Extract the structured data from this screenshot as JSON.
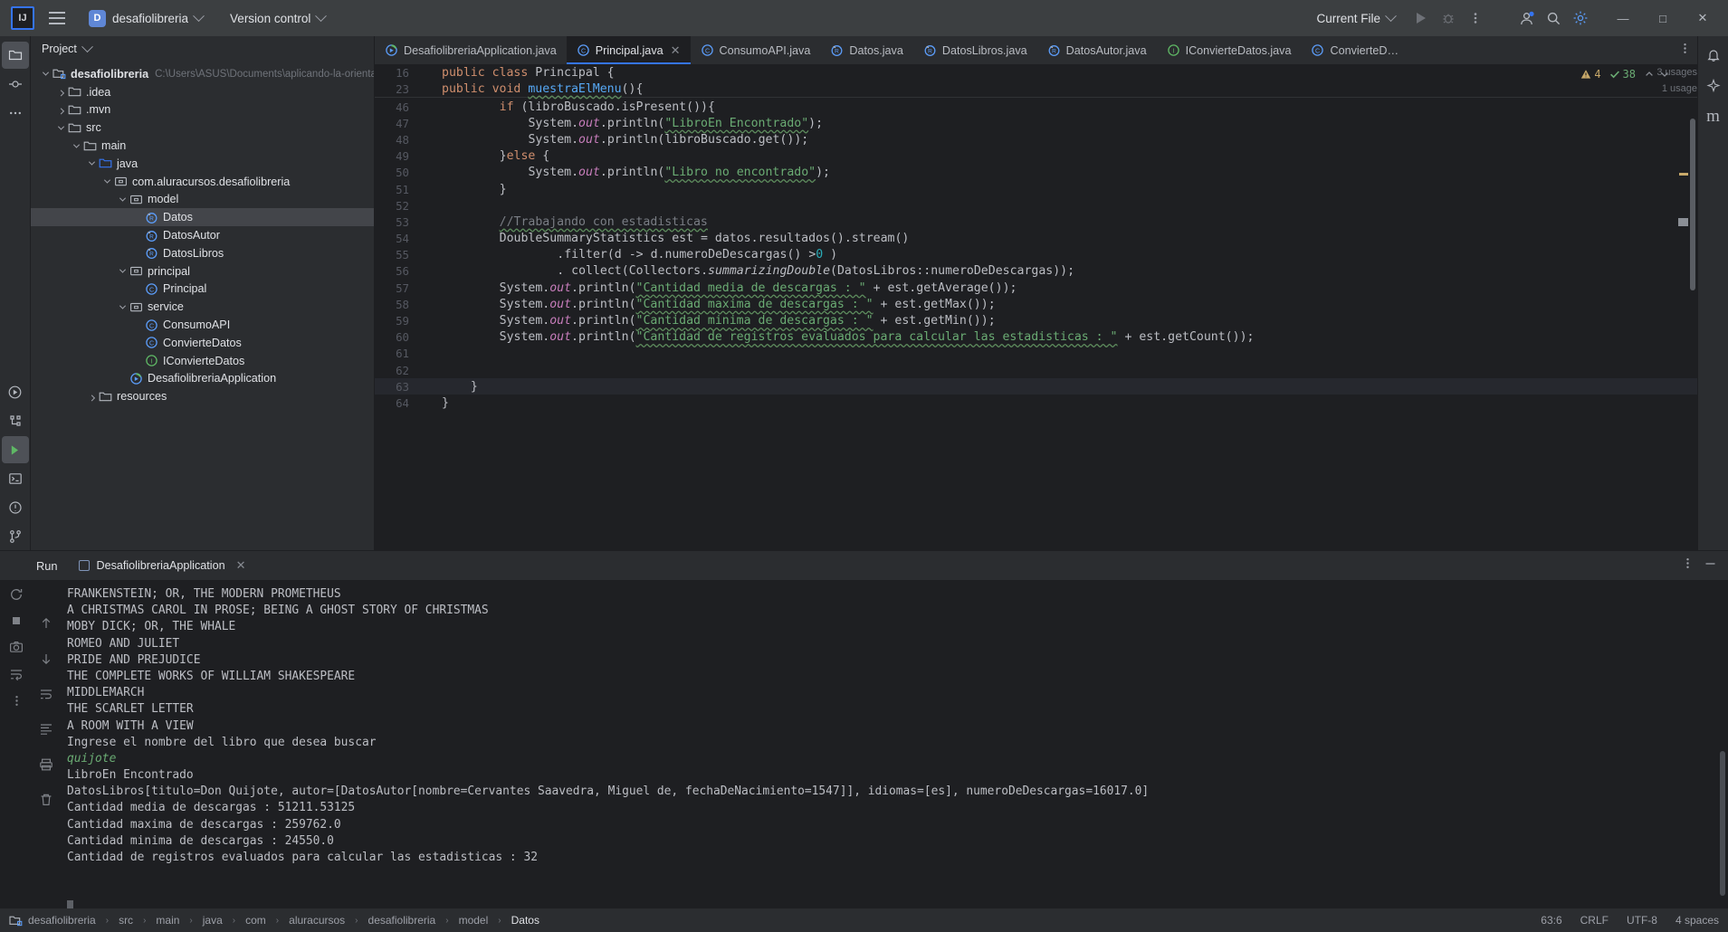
{
  "titlebar": {
    "logo_icon": "intellij-logo-icon",
    "menu_icon": "hamburger-menu-icon",
    "project_badge": "D",
    "project_name": "desafiolibreria",
    "vcs_label": "Version control",
    "run_config": "Current File",
    "run_icon": "run-play-icon",
    "debug_icon": "debug-bug-icon",
    "more_icon": "more-vertical-icon",
    "account_icon": "user-account-icon",
    "search_icon": "search-icon",
    "settings_icon": "gear-icon",
    "minimize": "—",
    "maximize": "□",
    "close": "✕"
  },
  "activity_bar_left": [
    {
      "name": "project-tool-window",
      "icon": "project-folder-icon",
      "selected": true
    },
    {
      "name": "commit-tool-window",
      "icon": "commit-icon",
      "selected": false
    },
    {
      "name": "more-tool-windows",
      "icon": "ellipsis-icon",
      "selected": false
    },
    {
      "name": "run-tool-window",
      "icon": "run-circle-icon",
      "selected": false
    },
    {
      "name": "structure-tool-window",
      "icon": "structure-icon",
      "selected": false
    },
    {
      "name": "services-tool-window",
      "icon": "services-run-icon",
      "selected": true
    },
    {
      "name": "terminal-tool-window",
      "icon": "terminal-icon",
      "selected": false
    },
    {
      "name": "problems-tool-window",
      "icon": "problems-warning-icon",
      "selected": false
    },
    {
      "name": "version-control-tool-window",
      "icon": "branch-icon",
      "selected": false
    }
  ],
  "activity_bar_right": [
    {
      "name": "notifications",
      "icon": "bell-icon"
    },
    {
      "name": "ai-assistant",
      "icon": "ai-sparkle-icon"
    },
    {
      "name": "maven-tool-window",
      "icon": "maven-m-icon",
      "label": "m"
    }
  ],
  "project_panel": {
    "header": "Project",
    "header_chevron": "chevron-down-icon",
    "tree": [
      {
        "depth": 0,
        "arrow": "down",
        "icon": "module-icon",
        "label": "desafiolibreria",
        "path": "C:\\Users\\ASUS\\Documents\\aplicando-la-orientac",
        "bold": true,
        "selected": false
      },
      {
        "depth": 1,
        "arrow": "right",
        "icon": "folder-icon",
        "label": ".idea",
        "selected": false
      },
      {
        "depth": 1,
        "arrow": "right",
        "icon": "folder-icon",
        "label": ".mvn",
        "selected": false
      },
      {
        "depth": 1,
        "arrow": "down",
        "icon": "folder-icon",
        "label": "src",
        "selected": false
      },
      {
        "depth": 2,
        "arrow": "down",
        "icon": "folder-icon",
        "label": "main",
        "selected": false
      },
      {
        "depth": 3,
        "arrow": "down",
        "icon": "source-root-icon",
        "label": "java",
        "selected": false
      },
      {
        "depth": 4,
        "arrow": "down",
        "icon": "package-icon",
        "label": "com.aluracursos.desafiolibreria",
        "selected": false
      },
      {
        "depth": 5,
        "arrow": "down",
        "icon": "package-icon",
        "label": "model",
        "selected": false
      },
      {
        "depth": 6,
        "arrow": "none",
        "icon": "record-icon",
        "label": "Datos",
        "selected": true
      },
      {
        "depth": 6,
        "arrow": "none",
        "icon": "record-icon",
        "label": "DatosAutor",
        "selected": false
      },
      {
        "depth": 6,
        "arrow": "none",
        "icon": "record-icon",
        "label": "DatosLibros",
        "selected": false
      },
      {
        "depth": 5,
        "arrow": "down",
        "icon": "package-icon",
        "label": "principal",
        "selected": false
      },
      {
        "depth": 6,
        "arrow": "none",
        "icon": "class-icon",
        "label": "Principal",
        "selected": false
      },
      {
        "depth": 5,
        "arrow": "down",
        "icon": "package-icon",
        "label": "service",
        "selected": false
      },
      {
        "depth": 6,
        "arrow": "none",
        "icon": "class-icon",
        "label": "ConsumoAPI",
        "selected": false
      },
      {
        "depth": 6,
        "arrow": "none",
        "icon": "class-icon",
        "label": "ConvierteDatos",
        "selected": false
      },
      {
        "depth": 6,
        "arrow": "none",
        "icon": "interface-icon",
        "label": "IConvierteDatos",
        "selected": false
      },
      {
        "depth": 5,
        "arrow": "none",
        "icon": "spring-app-icon",
        "label": "DesafiolibreriaApplication",
        "selected": false
      },
      {
        "depth": 3,
        "arrow": "right",
        "icon": "resources-icon",
        "label": "resources",
        "selected": false
      }
    ]
  },
  "editor": {
    "tabs": [
      {
        "label": "DesafiolibreriaApplication.java",
        "icon": "spring-app-icon",
        "active": false,
        "closable": false
      },
      {
        "label": "Principal.java",
        "icon": "class-icon",
        "active": true,
        "closable": true
      },
      {
        "label": "ConsumoAPI.java",
        "icon": "class-icon",
        "active": false,
        "closable": false
      },
      {
        "label": "Datos.java",
        "icon": "record-icon",
        "active": false,
        "closable": false
      },
      {
        "label": "DatosLibros.java",
        "icon": "record-icon",
        "active": false,
        "closable": false
      },
      {
        "label": "DatosAutor.java",
        "icon": "record-icon",
        "active": false,
        "closable": false
      },
      {
        "label": "IConvierteDatos.java",
        "icon": "interface-icon",
        "active": false,
        "closable": false
      },
      {
        "label": "ConvierteD…",
        "icon": "class-icon",
        "active": false,
        "closable": false
      }
    ],
    "inspection": {
      "warning_count": "4",
      "warning_icon": "warning-triangle-icon",
      "ok_count": "38",
      "ok_icon": "check-icon",
      "up_icon": "chevron-up-icon",
      "down_icon": "chevron-down-icon"
    },
    "sticky_lines": [
      {
        "num": "16",
        "text": "public class Principal {",
        "usages": "3 usages"
      },
      {
        "num": "23",
        "text": "public void muestraElMenu(){",
        "usages": "1 usage"
      }
    ],
    "code_lines": [
      {
        "num": "46",
        "text": "        if (libroBuscado.isPresent()){"
      },
      {
        "num": "47",
        "text": "            System.out.println(\"LibroEn Encontrado\");"
      },
      {
        "num": "48",
        "text": "            System.out.println(libroBuscado.get());"
      },
      {
        "num": "49",
        "text": "        }else {"
      },
      {
        "num": "50",
        "text": "            System.out.println(\"Libro no encontrado\");"
      },
      {
        "num": "51",
        "text": "        }"
      },
      {
        "num": "52",
        "text": ""
      },
      {
        "num": "53",
        "text": "        //Trabajando con estadisticas"
      },
      {
        "num": "54",
        "text": "        DoubleSummaryStatistics est = datos.resultados().stream()"
      },
      {
        "num": "55",
        "text": "                .filter(d -> d.numeroDeDescargas() >0 )"
      },
      {
        "num": "56",
        "text": "                . collect(Collectors.summarizingDouble(DatosLibros::numeroDeDescargas));"
      },
      {
        "num": "57",
        "text": "        System.out.println(\"Cantidad media de descargas : \" + est.getAverage());"
      },
      {
        "num": "58",
        "text": "        System.out.println(\"Cantidad maxima de descargas : \" + est.getMax());"
      },
      {
        "num": "59",
        "text": "        System.out.println(\"Cantidad minima de descargas : \" + est.getMin());"
      },
      {
        "num": "60",
        "text": "        System.out.println(\"Cantidad de registros evaluados para calcular las estadisticas : \" + est.getCount());"
      },
      {
        "num": "61",
        "text": ""
      },
      {
        "num": "62",
        "text": ""
      },
      {
        "num": "63",
        "text": "    }"
      },
      {
        "num": "64",
        "text": "}"
      }
    ]
  },
  "run_panel": {
    "title": "Run",
    "tab_label": "DesafiolibreriaApplication",
    "tab_close": "✕",
    "more_icon": "more-vertical-icon",
    "minimize_icon": "minimize-icon",
    "tools": [
      {
        "name": "rerun-button",
        "icon": "rerun-icon"
      },
      {
        "name": "stop-button",
        "icon": "stop-square-icon"
      },
      {
        "name": "screenshot-button",
        "icon": "camera-icon"
      },
      {
        "name": "wrap-button",
        "icon": "wrap-icon"
      },
      {
        "name": "more-run-actions",
        "icon": "more-vertical-icon"
      }
    ],
    "side_tools": [
      {
        "name": "scroll-up-button",
        "icon": "arrow-up-icon"
      },
      {
        "name": "scroll-down-button",
        "icon": "arrow-down-icon"
      },
      {
        "name": "soft-wrap-button",
        "icon": "soft-wrap-icon"
      },
      {
        "name": "scroll-to-end-button",
        "icon": "scroll-end-icon"
      },
      {
        "name": "print-button",
        "icon": "print-icon"
      },
      {
        "name": "clear-all-button",
        "icon": "trash-icon"
      }
    ],
    "console_lines": [
      {
        "text": "FRANKENSTEIN; OR, THE MODERN PROMETHEUS",
        "kind": "out"
      },
      {
        "text": "A CHRISTMAS CAROL IN PROSE; BEING A GHOST STORY OF CHRISTMAS",
        "kind": "out"
      },
      {
        "text": "MOBY DICK; OR, THE WHALE",
        "kind": "out"
      },
      {
        "text": "ROMEO AND JULIET",
        "kind": "out"
      },
      {
        "text": "PRIDE AND PREJUDICE",
        "kind": "out"
      },
      {
        "text": "THE COMPLETE WORKS OF WILLIAM SHAKESPEARE",
        "kind": "out"
      },
      {
        "text": "MIDDLEMARCH",
        "kind": "out"
      },
      {
        "text": "THE SCARLET LETTER",
        "kind": "out"
      },
      {
        "text": "A ROOM WITH A VIEW",
        "kind": "out"
      },
      {
        "text": "Ingrese el nombre del libro que desea buscar",
        "kind": "out"
      },
      {
        "text": "quijote",
        "kind": "in"
      },
      {
        "text": "LibroEn Encontrado",
        "kind": "out"
      },
      {
        "text": "DatosLibros[titulo=Don Quijote, autor=[DatosAutor[nombre=Cervantes Saavedra, Miguel de, fechaDeNacimiento=1547]], idiomas=[es], numeroDeDescargas=16017.0]",
        "kind": "out"
      },
      {
        "text": "Cantidad media de descargas : 51211.53125",
        "kind": "out"
      },
      {
        "text": "Cantidad maxima de descargas : 259762.0",
        "kind": "out"
      },
      {
        "text": "Cantidad minima de descargas : 24550.0",
        "kind": "out"
      },
      {
        "text": "Cantidad de registros evaluados para calcular las estadisticas : 32",
        "kind": "out"
      }
    ]
  },
  "status_bar": {
    "breadcrumb": [
      "desafiolibreria",
      "src",
      "main",
      "java",
      "com",
      "aluracursos",
      "desafiolibreria",
      "model",
      "Datos"
    ],
    "breadcrumb_icon": "module-icon",
    "caret_position": "63:6",
    "line_separator": "CRLF",
    "encoding": "UTF-8",
    "indent": "4 spaces"
  }
}
